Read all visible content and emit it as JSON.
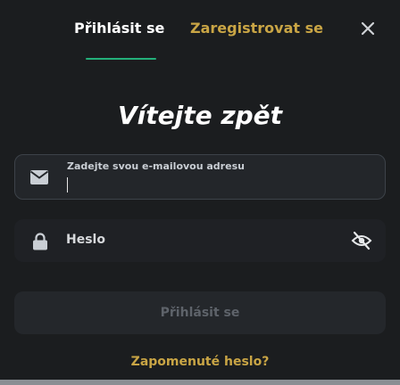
{
  "tabs": {
    "login_label": "Přihlásit se",
    "register_label": "Zaregistrovat se"
  },
  "title": "Vítejte zpět",
  "email": {
    "label": "Zadejte svou e-mailovou adresu",
    "value": ""
  },
  "password": {
    "label": "Heslo"
  },
  "submit_label": "Přihlásit se",
  "forgot_label": "Zapomenuté heslo?",
  "icons": {
    "close": "close-icon",
    "email": "envelope-icon",
    "lock": "lock-icon",
    "visibility": "eye-off-icon"
  },
  "colors": {
    "background": "#1b1d1f",
    "active_tab": "#ffffff",
    "accent_gold": "#c9a545",
    "tab_underline": "#23b07a",
    "button_disabled_bg": "#24272b",
    "button_disabled_text": "#5e636a"
  }
}
